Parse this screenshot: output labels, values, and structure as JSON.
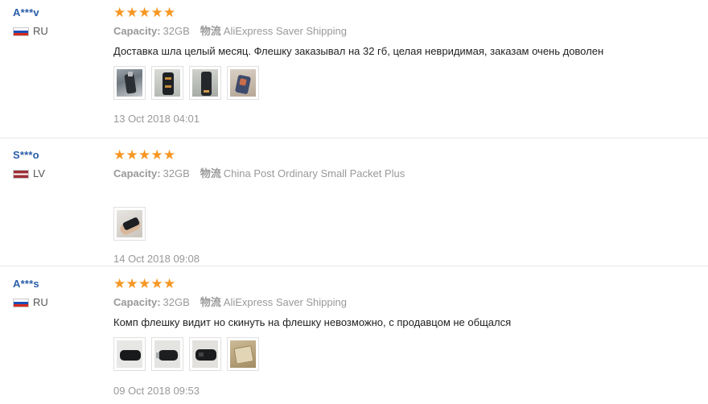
{
  "reviews": [
    {
      "user": "A***v",
      "country": "RU",
      "flag": "ru",
      "rating": 5,
      "capacity_label": "Capacity:",
      "capacity_value": "32GB",
      "shipping_label": "物流",
      "shipping_value": "AliExpress Saver Shipping",
      "text": "Доставка шла целый месяц. Флешку заказывал на 32 гб, целая невридимая, заказам очень доволен",
      "photos": [
        "photo-flashdrive-1",
        "photo-flashdrive-2",
        "photo-flashdrive-3",
        "photo-flashdrive-4"
      ],
      "date": "13 Oct 2018 04:01"
    },
    {
      "user": "S***o",
      "country": "LV",
      "flag": "lv",
      "rating": 5,
      "capacity_label": "Capacity:",
      "capacity_value": "32GB",
      "shipping_label": "物流",
      "shipping_value": "China Post Ordinary Small Packet Plus",
      "text": "",
      "photos": [
        "photo-flashdrive-hand"
      ],
      "date": "14 Oct 2018 09:08"
    },
    {
      "user": "A***s",
      "country": "RU",
      "flag": "ru",
      "rating": 5,
      "capacity_label": "Capacity:",
      "capacity_value": "32GB",
      "shipping_label": "物流",
      "shipping_value": "AliExpress Saver Shipping",
      "text": "Комп флешку видит но скинуть на флешку невозможно, с продавцом не общался",
      "photos": [
        "photo-flashdrive-black-1",
        "photo-flashdrive-black-2",
        "photo-flashdrive-black-3",
        "photo-package"
      ],
      "date": "09 Oct 2018 09:53"
    }
  ],
  "colors": {
    "star": "#f69723",
    "username": "#2a5ea8",
    "meta": "#999999",
    "text": "#222222"
  }
}
